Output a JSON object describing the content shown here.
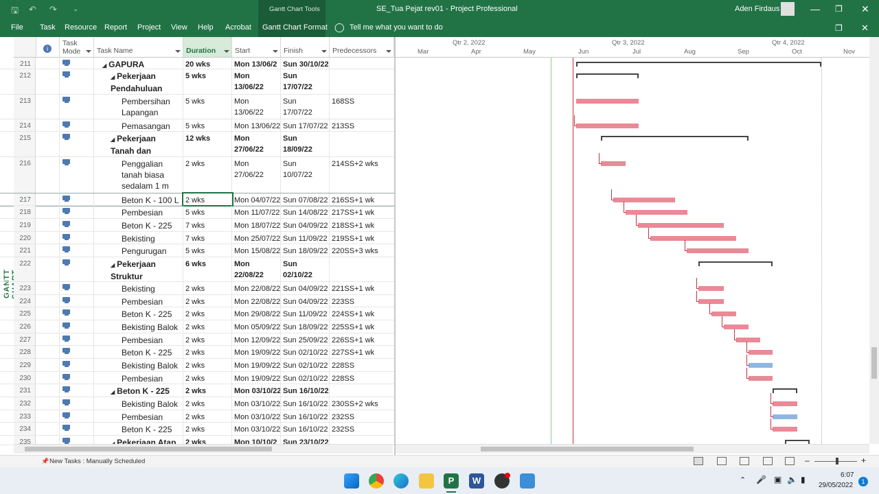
{
  "window": {
    "title": "SE_Tua Pejat rev01  -  Project Professional",
    "context_tab": "Gantt Chart Tools",
    "user": "Aden Firdaus"
  },
  "ribbon": {
    "tabs": [
      "File",
      "Task",
      "Resource",
      "Report",
      "Project",
      "View",
      "Help",
      "Acrobat",
      "Gantt Chart Format"
    ],
    "tell_me": "Tell me what you want to do"
  },
  "view_label": "GANTT CHART",
  "columns": {
    "mode": "Task Mode",
    "name": "Task Name",
    "duration": "Duration",
    "start": "Start",
    "finish": "Finish",
    "pred": "Predecessors"
  },
  "timescale": {
    "quarters": [
      "Qtr 2, 2022",
      "Qtr 3, 2022",
      "Qtr 4, 2022"
    ],
    "months": [
      "Mar",
      "Apr",
      "May",
      "Jun",
      "Jul",
      "Aug",
      "Sep",
      "Oct",
      "Nov"
    ]
  },
  "rows": [
    {
      "id": "211",
      "name": "GAPURA",
      "dur": "20 wks",
      "start": "Mon 13/06/2",
      "fin": "Sun 30/10/22",
      "pred": "",
      "summary": true,
      "indent": 0
    },
    {
      "id": "212",
      "name": "Pekerjaan Pendahuluan",
      "dur": "5 wks",
      "start": "Mon 13/06/22",
      "fin": "Sun 17/07/22",
      "pred": "",
      "summary": true,
      "indent": 1
    },
    {
      "id": "213",
      "name": "Pembersihan Lapangan",
      "dur": "5 wks",
      "start": "Mon 13/06/22",
      "fin": "Sun 17/07/22",
      "pred": "168SS",
      "summary": false,
      "indent": 2
    },
    {
      "id": "214",
      "name": "Pemasangan Bo",
      "dur": "5 wks",
      "start": "Mon 13/06/22",
      "fin": "Sun 17/07/22",
      "pred": "213SS",
      "summary": false,
      "indent": 2
    },
    {
      "id": "215",
      "name": "Pekerjaan Tanah dan Pondasi",
      "dur": "12 wks",
      "start": "Mon 27/06/22",
      "fin": "Sun 18/09/22",
      "pred": "",
      "summary": true,
      "indent": 1
    },
    {
      "id": "216",
      "name": "Penggalian tanah biasa sedalam 1 m",
      "dur": "2 wks",
      "start": "Mon 27/06/22",
      "fin": "Sun 10/07/22",
      "pred": "214SS+2 wks",
      "summary": false,
      "indent": 2
    },
    {
      "id": "217",
      "name": "Beton K - 100 L",
      "dur": "2 wks",
      "start": "Mon 04/07/22",
      "fin": "Sun 07/08/22",
      "pred": "216SS+1 wk",
      "summary": false,
      "indent": 2
    },
    {
      "id": "218",
      "name": "Pembesian",
      "dur": "5 wks",
      "start": "Mon 11/07/22",
      "fin": "Sun 14/08/22",
      "pred": "217SS+1 wk",
      "summary": false,
      "indent": 2
    },
    {
      "id": "219",
      "name": "Beton K - 225",
      "dur": "7 wks",
      "start": "Mon 18/07/22",
      "fin": "Sun 04/09/22",
      "pred": "218SS+1 wk",
      "summary": false,
      "indent": 2
    },
    {
      "id": "220",
      "name": "Bekisting Ponda",
      "dur": "7 wks",
      "start": "Mon 25/07/22",
      "fin": "Sun 11/09/22",
      "pred": "219SS+1 wk",
      "summary": false,
      "indent": 2
    },
    {
      "id": "221",
      "name": "Pengurugan Ker",
      "dur": "5 wks",
      "start": "Mon 15/08/22",
      "fin": "Sun 18/09/22",
      "pred": "220SS+3 wks",
      "summary": false,
      "indent": 2
    },
    {
      "id": "222",
      "name": "Pekerjaan Struktur",
      "dur": "6 wks",
      "start": "Mon 22/08/22",
      "fin": "Sun 02/10/22",
      "pred": "",
      "summary": true,
      "indent": 1
    },
    {
      "id": "223",
      "name": "Bekisting Kolom",
      "dur": "2 wks",
      "start": "Mon 22/08/22",
      "fin": "Sun 04/09/22",
      "pred": "221SS+1 wk",
      "summary": false,
      "indent": 2
    },
    {
      "id": "224",
      "name": "Pembesian",
      "dur": "2 wks",
      "start": "Mon 22/08/22",
      "fin": "Sun 04/09/22",
      "pred": "223SS",
      "summary": false,
      "indent": 2
    },
    {
      "id": "225",
      "name": "Beton K - 225",
      "dur": "2 wks",
      "start": "Mon 29/08/22",
      "fin": "Sun 11/09/22",
      "pred": "224SS+1 wk",
      "summary": false,
      "indent": 2
    },
    {
      "id": "226",
      "name": "Bekisting Balok",
      "dur": "2 wks",
      "start": "Mon 05/09/22",
      "fin": "Sun 18/09/22",
      "pred": "225SS+1 wk",
      "summary": false,
      "indent": 2
    },
    {
      "id": "227",
      "name": "Pembesian",
      "dur": "2 wks",
      "start": "Mon 12/09/22",
      "fin": "Sun 25/09/22",
      "pred": "226SS+1 wk",
      "summary": false,
      "indent": 2
    },
    {
      "id": "228",
      "name": "Beton K - 225",
      "dur": "2 wks",
      "start": "Mon 19/09/22",
      "fin": "Sun 02/10/22",
      "pred": "227SS+1 wk",
      "summary": false,
      "indent": 2
    },
    {
      "id": "229",
      "name": "Bekisting Balok",
      "dur": "2 wks",
      "start": "Mon 19/09/22",
      "fin": "Sun 02/10/22",
      "pred": "228SS",
      "summary": false,
      "indent": 2
    },
    {
      "id": "230",
      "name": "Pembesian",
      "dur": "2 wks",
      "start": "Mon 19/09/22",
      "fin": "Sun 02/10/22",
      "pred": "228SS",
      "summary": false,
      "indent": 2
    },
    {
      "id": "231",
      "name": "Beton K - 225",
      "dur": "2 wks",
      "start": "Mon 03/10/22",
      "fin": "Sun 16/10/22",
      "pred": "",
      "summary": true,
      "indent": 1
    },
    {
      "id": "232",
      "name": "Bekisting Balok",
      "dur": "2 wks",
      "start": "Mon 03/10/22",
      "fin": "Sun 16/10/22",
      "pred": "230SS+2 wks",
      "summary": false,
      "indent": 2
    },
    {
      "id": "233",
      "name": "Pembesian",
      "dur": "2 wks",
      "start": "Mon 03/10/22",
      "fin": "Sun 16/10/22",
      "pred": "232SS",
      "summary": false,
      "indent": 2
    },
    {
      "id": "234",
      "name": "Beton K - 225",
      "dur": "2 wks",
      "start": "Mon 03/10/22",
      "fin": "Sun 16/10/22",
      "pred": "232SS",
      "summary": false,
      "indent": 2
    },
    {
      "id": "235",
      "name": "Pekerjaan Atap",
      "dur": "2 wks",
      "start": "Mon 10/10/2",
      "fin": "Sun 23/10/22",
      "pred": "",
      "summary": true,
      "indent": 1
    }
  ],
  "status": {
    "new_tasks": "New Tasks : Manually Scheduled"
  },
  "clock": {
    "time": "6:07",
    "date": "29/05/2022"
  },
  "colors": {
    "brand": "#217346",
    "task_bar": "#e98a96",
    "selected_bar": "#8db6e3"
  }
}
